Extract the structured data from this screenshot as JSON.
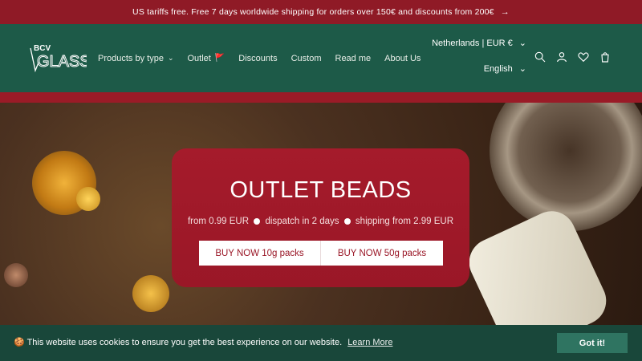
{
  "announcement": {
    "text": "US tariffs free. Free 7 days worldwide shipping for orders over 150€ and discounts from 200€",
    "arrow": "→"
  },
  "logo": {
    "text_top": "BCV",
    "text_main": "GLASS"
  },
  "nav": {
    "items": [
      {
        "label": "Products by type",
        "has_dropdown": true
      },
      {
        "label": "Outlet",
        "flag": "🚩"
      },
      {
        "label": "Discounts"
      },
      {
        "label": "Custom"
      },
      {
        "label": "Read me"
      },
      {
        "label": "About Us"
      }
    ]
  },
  "locale": {
    "country": "Netherlands | EUR €",
    "language": "English"
  },
  "icons": [
    "search-icon",
    "account-icon",
    "wishlist-icon",
    "cart-icon"
  ],
  "hero": {
    "title": "OUTLET BEADS",
    "sub_parts": [
      "from 0.99 EUR",
      "dispatch in 2 days",
      "shipping from 2.99 EUR"
    ],
    "button_1": "BUY NOW 10g packs",
    "button_2": "BUY NOW 50g packs"
  },
  "cookie": {
    "emoji": "🍪",
    "message": "This website uses cookies to ensure you get the best experience on our website.",
    "learn_more": "Learn More",
    "accept": "Got it!"
  },
  "colors": {
    "brand_green": "#1d5a48",
    "brand_red": "#9a1b27"
  }
}
